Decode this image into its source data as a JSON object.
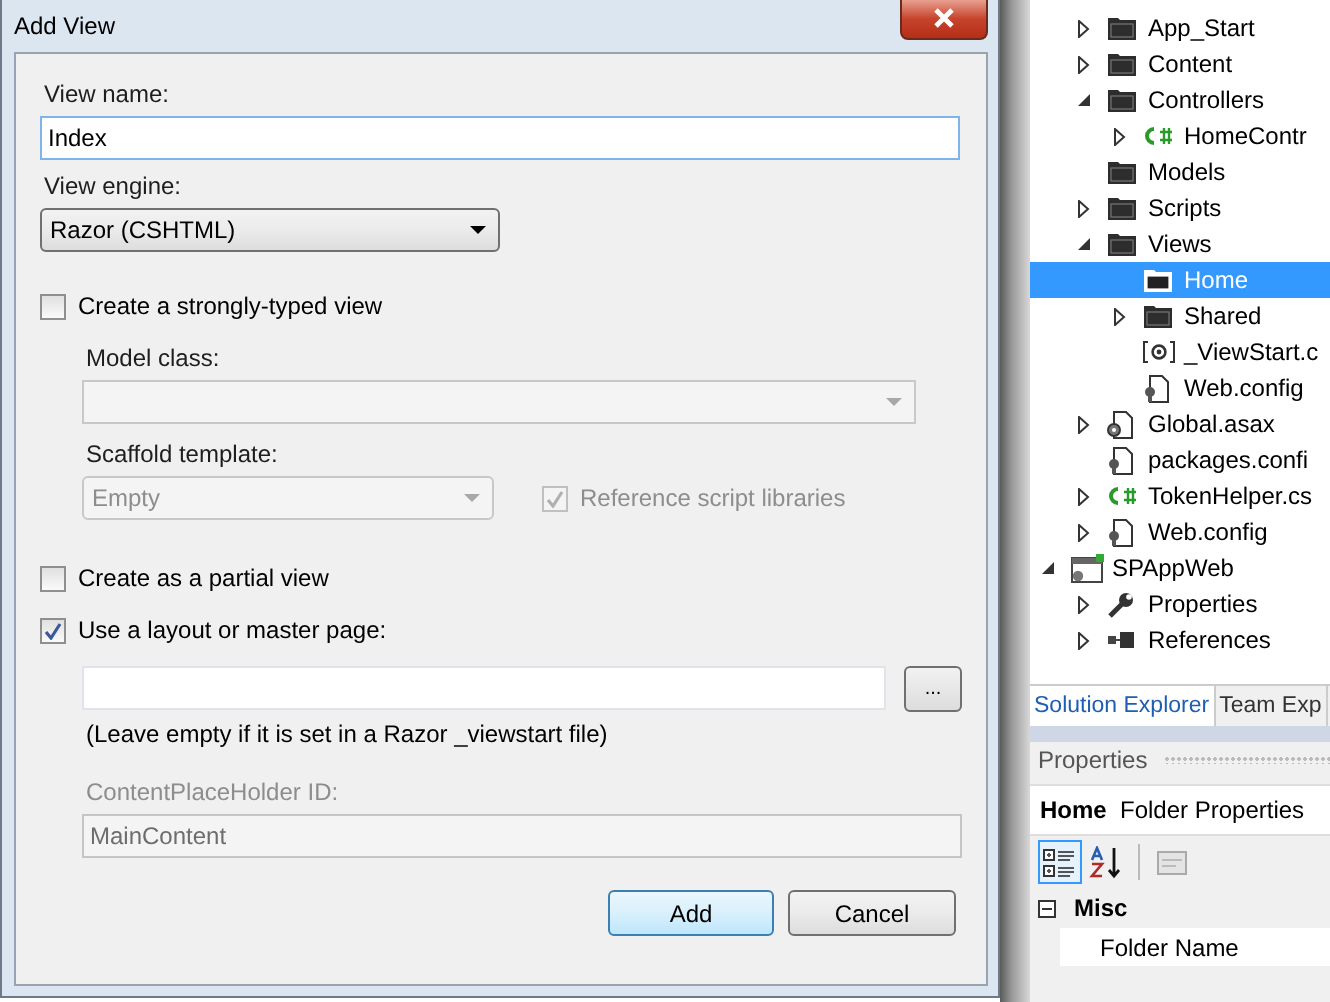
{
  "dialog": {
    "title": "Add View",
    "view_name": {
      "label": "View name:",
      "value": "Index"
    },
    "view_engine": {
      "label": "View engine:",
      "value": "Razor (CSHTML)"
    },
    "strongly_typed": {
      "label": "Create a strongly-typed view",
      "checked": false
    },
    "model_class": {
      "label": "Model class:",
      "disabled": true
    },
    "scaffold_template": {
      "label": "Scaffold template:",
      "value": "Empty",
      "disabled": true
    },
    "reference_scripts": {
      "label": "Reference script libraries",
      "checked": true,
      "disabled": true
    },
    "partial_view": {
      "label": "Create as a partial view",
      "checked": false
    },
    "use_layout": {
      "label": "Use a layout or master page:",
      "checked": true
    },
    "layout_browse": "...",
    "layout_hint": "(Leave empty if it is set in a Razor _viewstart file)",
    "placeholder_id": {
      "label": "ContentPlaceHolder ID:",
      "value": "MainContent",
      "disabled": true
    },
    "buttons": [
      {
        "label": "Add",
        "default": true
      },
      {
        "label": "Cancel",
        "default": false
      }
    ]
  },
  "solution_explorer": {
    "items": [
      {
        "label": "App_Start",
        "kind": "folder",
        "expanded": false,
        "selected": false
      },
      {
        "label": "Content",
        "kind": "folder",
        "expanded": false,
        "selected": false
      },
      {
        "label": "Controllers",
        "kind": "folder",
        "expanded": true,
        "selected": false,
        "children": [
          {
            "label": "HomeContr",
            "kind": "cs",
            "expanded": false,
            "selected": false
          }
        ]
      },
      {
        "label": "Models",
        "kind": "folder",
        "selected": false
      },
      {
        "label": "Scripts",
        "kind": "folder",
        "expanded": false,
        "selected": false
      },
      {
        "label": "Views",
        "kind": "folder",
        "expanded": true,
        "selected": false,
        "children": [
          {
            "label": "Home",
            "kind": "folder",
            "selected": true
          },
          {
            "label": "Shared",
            "kind": "folder",
            "expanded": false,
            "selected": false
          },
          {
            "label": "_ViewStart.c",
            "kind": "razor",
            "selected": false
          },
          {
            "label": "Web.config",
            "kind": "config",
            "selected": false
          }
        ]
      },
      {
        "label": "Global.asax",
        "kind": "asax",
        "expanded": false,
        "selected": false
      },
      {
        "label": "packages.confi",
        "kind": "config",
        "selected": false
      },
      {
        "label": "TokenHelper.cs",
        "kind": "cs",
        "expanded": false,
        "selected": false
      },
      {
        "label": "Web.config",
        "kind": "config",
        "expanded": false,
        "selected": false
      }
    ],
    "projects": [
      {
        "label": "SPAppWeb",
        "kind": "project",
        "expanded": true,
        "selected": false,
        "children": [
          {
            "label": "Properties",
            "kind": "wrench",
            "expanded": false,
            "selected": false
          },
          {
            "label": "References",
            "kind": "refs",
            "expanded": false,
            "selected": false
          }
        ]
      }
    ]
  },
  "tabs": [
    {
      "label": "Solution Explorer",
      "selected": true
    },
    {
      "label": "Team Exp",
      "selected": false
    }
  ],
  "properties": {
    "title": "Properties",
    "object_name": "Home",
    "object_type": "Folder Properties",
    "toolbar": [
      {
        "kind": "categorized",
        "selected": true
      },
      {
        "kind": "alphabetical",
        "selected": false
      },
      {
        "kind": "pages",
        "selected": false
      }
    ],
    "category": {
      "label": "Misc",
      "expanded": true
    },
    "rows": [
      {
        "name": "Folder Name"
      }
    ]
  }
}
